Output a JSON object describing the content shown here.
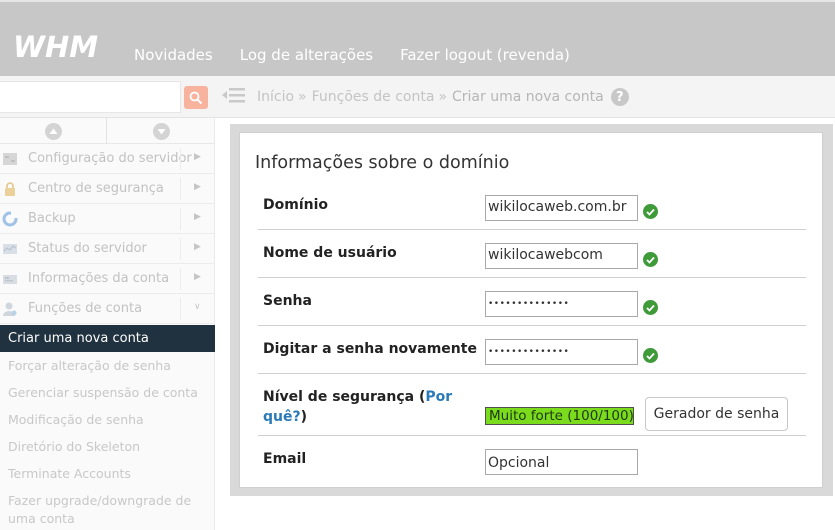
{
  "header": {
    "logo_text": "WHM",
    "nav": [
      "Novidades",
      "Log de alterações",
      "Fazer logout (revenda)"
    ]
  },
  "search": {
    "value": "",
    "placeholder": ""
  },
  "breadcrumb": {
    "home": "Início",
    "section": "Funções de conta",
    "current": "Criar uma nova conta",
    "sep": "»",
    "help": "?"
  },
  "sidebar": {
    "categories": [
      {
        "label": "Configuração do servidor",
        "icon": "server-config-icon",
        "indicator": "▶"
      },
      {
        "label": "Centro de segurança",
        "icon": "lock-icon",
        "indicator": "▶"
      },
      {
        "label": "Backup",
        "icon": "backup-icon",
        "indicator": "▶"
      },
      {
        "label": "Status do servidor",
        "icon": "server-status-icon",
        "indicator": "▶"
      },
      {
        "label": "Informações da conta",
        "icon": "account-info-icon",
        "indicator": "▶"
      },
      {
        "label": "Funções de conta",
        "icon": "user-icon",
        "indicator": "∨"
      }
    ],
    "active_item": "Criar uma nova conta",
    "items": [
      "Forçar alteração de senha",
      "Gerenciar suspensão de conta",
      "Modificação de senha",
      "Diretório do Skeleton",
      "Terminate Accounts",
      "Fazer upgrade/downgrade de uma conta"
    ]
  },
  "form": {
    "title": "Informações sobre o domínio",
    "domain": {
      "label": "Domínio",
      "value": "wikilocaweb.com.br"
    },
    "username": {
      "label": "Nome de usuário",
      "value": "wikilocawebcom"
    },
    "password": {
      "label": "Senha",
      "value": "••••••••••••••"
    },
    "password_confirm": {
      "label": "Digitar a senha novamente",
      "value": "••••••••••••••"
    },
    "security": {
      "label_prefix": "Nível de segurança (",
      "link_line1": "Por",
      "link_line2": "quê?",
      "label_suffix": ")",
      "strength_text": "Muito forte (100/100)",
      "strength_color": "#7bdb1d",
      "generator_button": "Gerador de senha"
    },
    "email": {
      "label": "Email",
      "placeholder": "Opcional",
      "value": ""
    }
  },
  "colors": {
    "topbar": "#c7c7c7",
    "active_sidebar": "#20313f",
    "check_green": "#3f9a3a",
    "search_button": "#f7b39e",
    "link": "#2a7ab8"
  }
}
